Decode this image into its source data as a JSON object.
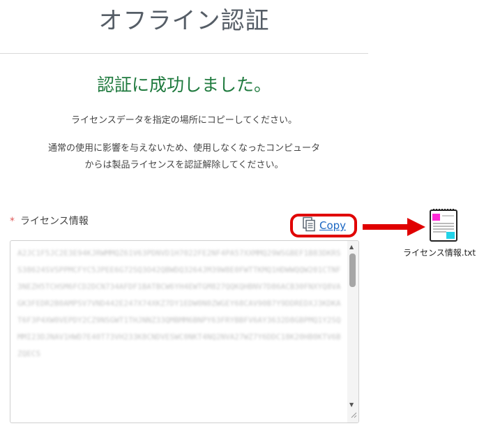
{
  "page": {
    "title": "オフライン認証",
    "success_message": "認証に成功しました。",
    "instruction_1": "ライセンスデータを指定の場所にコピーしてください。",
    "instruction_2_line1": "通常の使用に影響を与えないため、使用しなくなったコンピュータ",
    "instruction_2_line2": "からは製品ライセンスを認証解除してください。"
  },
  "license": {
    "required_mark": "*",
    "label": "ライセンス情報",
    "copy_label": "Copy",
    "value": "A2JC1F5JC2E3E94KJRWMMQZ61V63PDNVD1H7022FE2NF4PA57XXMMQ29WSGBEF1B83DKRSS38624SVSPPMCFYC5JPEE6G72SQ3O42QBWDQ3264JM39W8E0FWTTKMQ1HDWWQQW201CTNF3NEZH5TCHSM6FCD2DCN734AFDF1BATBCW6YH4EWTGM827QQKQHBNV7D86ACB30FNXYQ8VAGK3FEDR2B0AMPSV7VND442E247X74XKZ7DY1EDW0N0ZWGEY68CAV90B7Y9DDREDXJ3KDKAT6F3P4XW0VEPDY2CZ9NSGWT1THJNNZ33QMBMM6BNPY63FRYBBFV6AY3632D8GBPMQ1Y2SQMMI23DJNAV1HWD7E40T73VH233K8CNDVESWC0NKT4NQ2NVA27WZ7Y6DDC18K20HB0KTV6BZQECS"
  },
  "file": {
    "name": "ライセンス情報.txt"
  },
  "colors": {
    "success": "#1f7a3e",
    "link": "#1a66c2",
    "highlight": "#e00000",
    "required": "#e05a5a"
  },
  "icons": {
    "copy": "copy-icon",
    "arrow": "arrow-right-icon",
    "file": "text-file-icon"
  }
}
